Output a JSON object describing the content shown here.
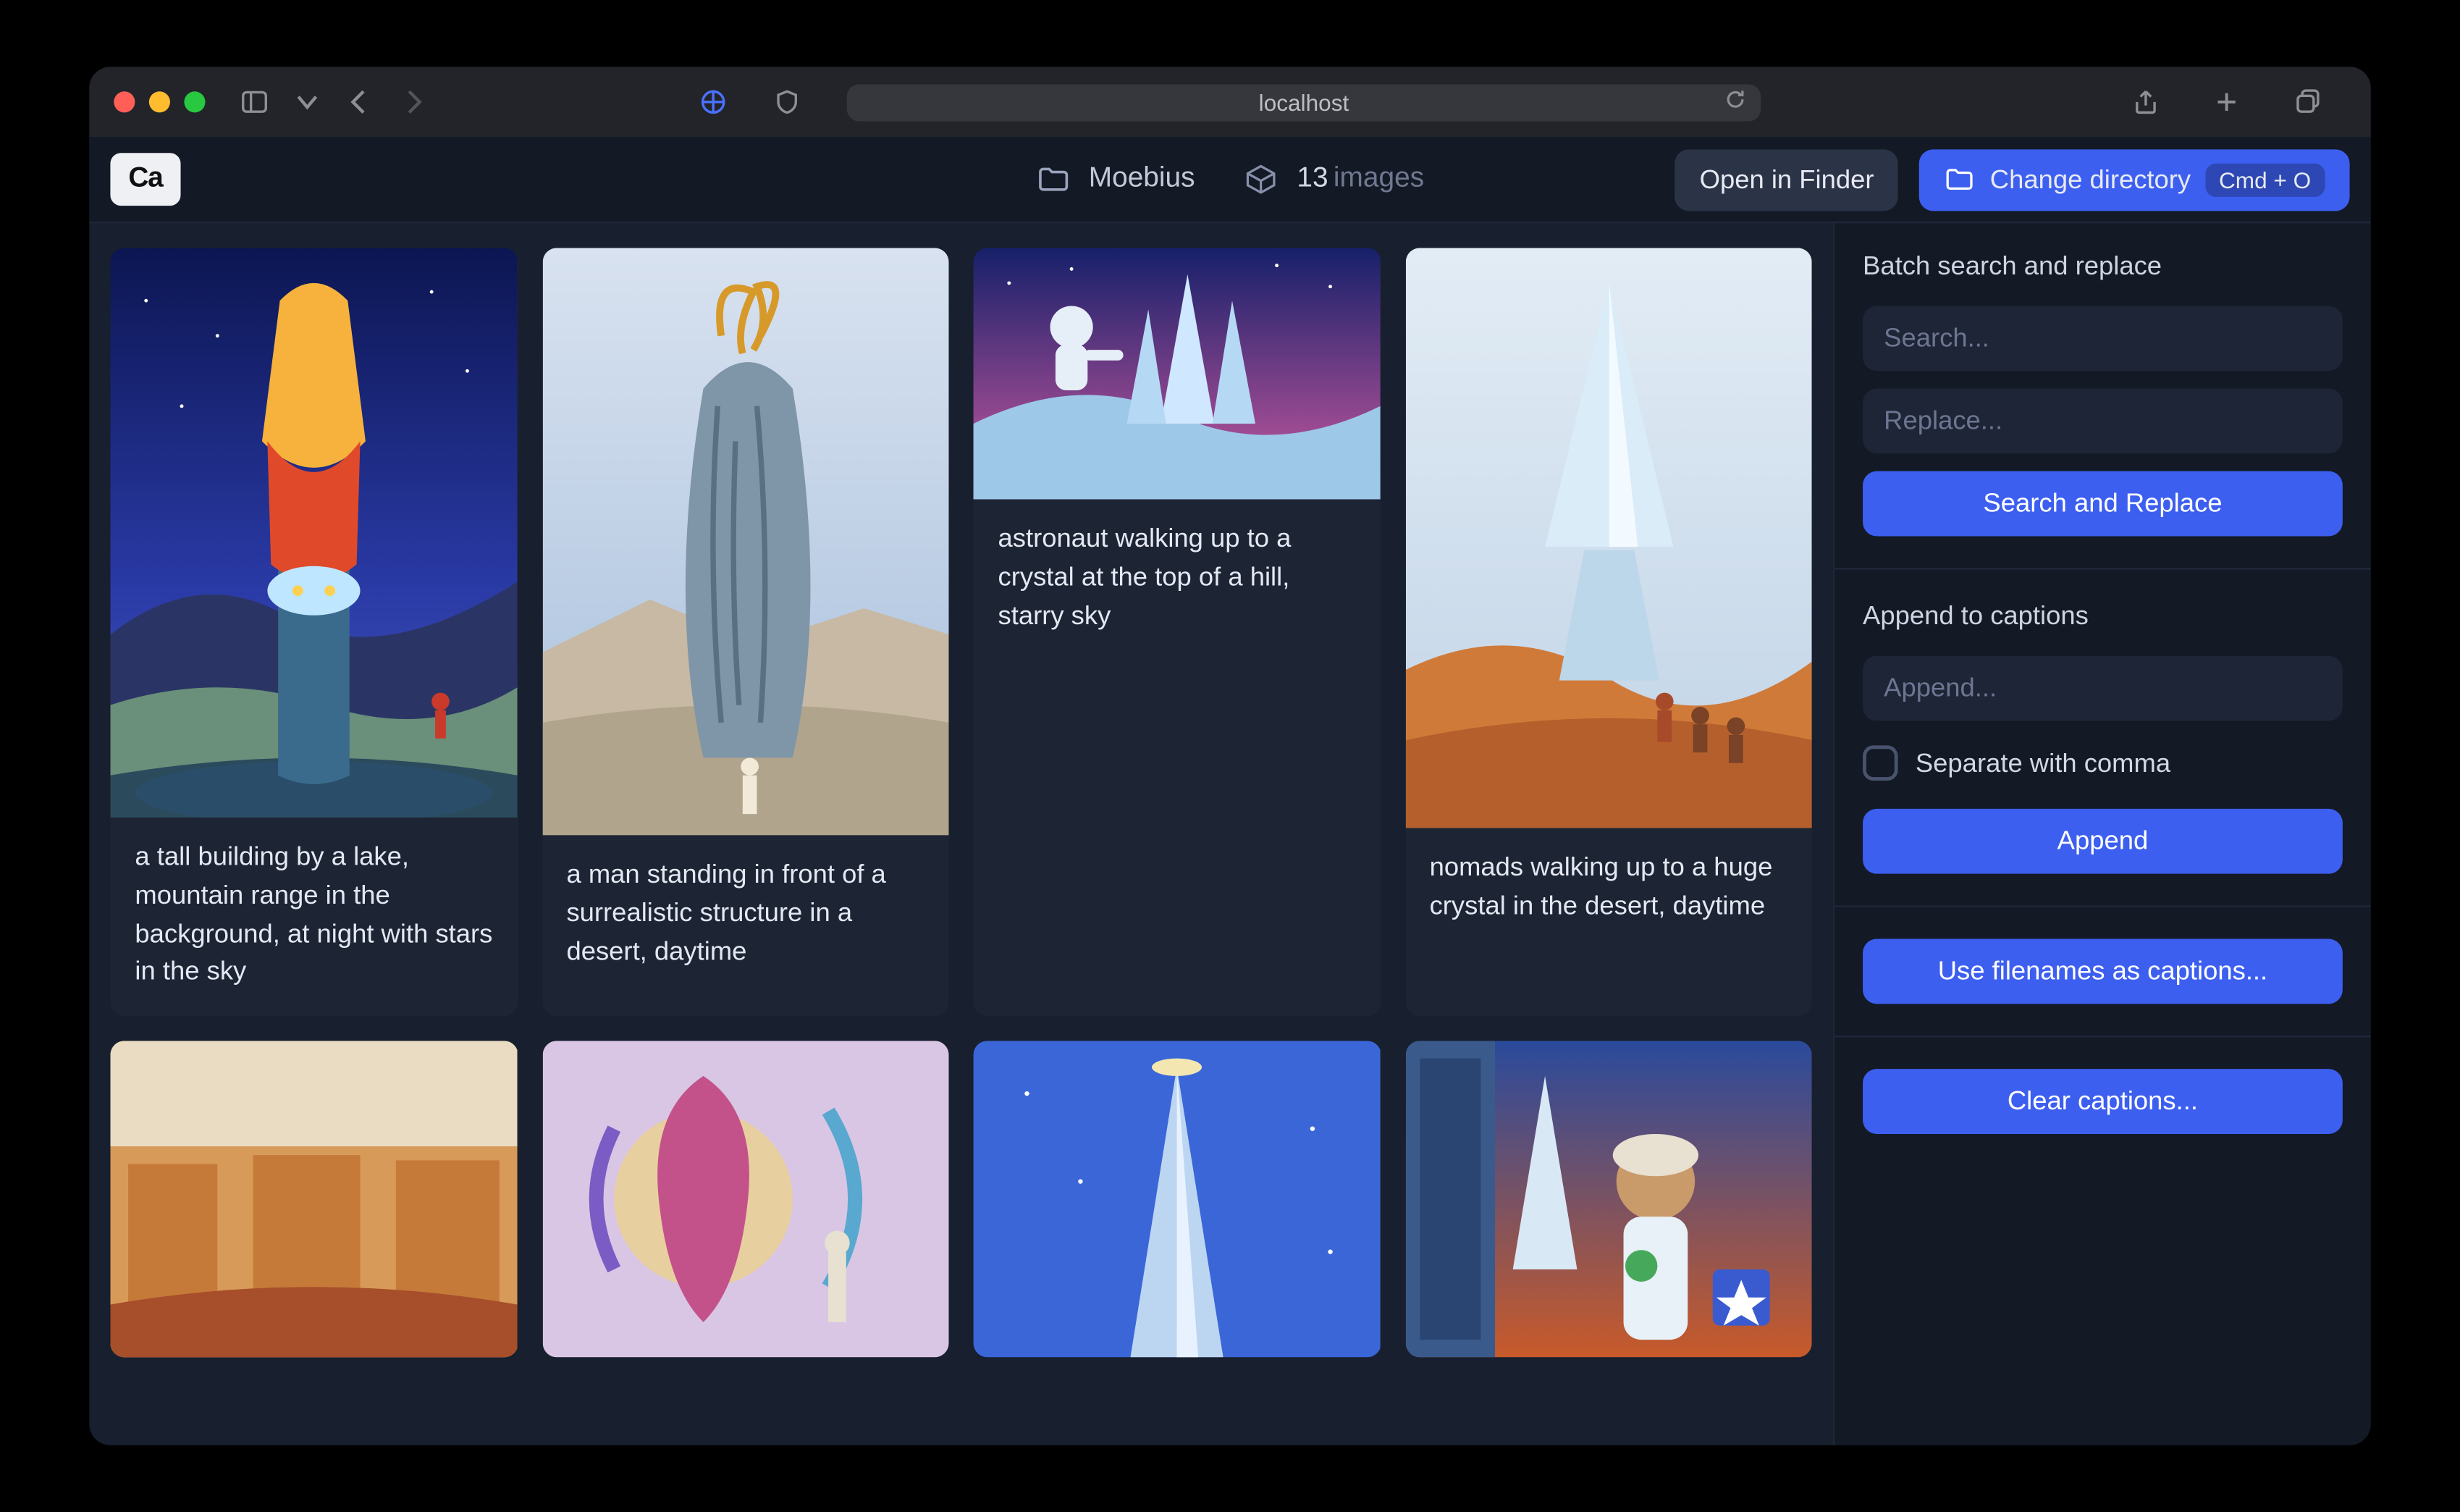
{
  "titlebar": {
    "address": "localhost"
  },
  "app": {
    "logo": "Ca",
    "folder_name": "Moebius",
    "image_count": "13",
    "image_word": "images",
    "open_finder": "Open in Finder",
    "change_dir": "Change directory",
    "change_dir_kbd": "Cmd + O"
  },
  "gallery": [
    {
      "caption": "a tall building by a lake, mountain range in the background, at night with stars in the sky"
    },
    {
      "caption": "a man standing in front of a surrealistic structure in a desert, daytime"
    },
    {
      "caption": "astronaut walking up to a crystal at the top of a hill, starry sky"
    },
    {
      "caption": "nomads walking up to a huge crystal in the desert, daytime"
    },
    {
      "caption": ""
    },
    {
      "caption": ""
    },
    {
      "caption": ""
    },
    {
      "caption": ""
    }
  ],
  "sidebar": {
    "batch_label": "Batch search and replace",
    "search_ph": "Search...",
    "replace_ph": "Replace...",
    "sr_btn": "Search and Replace",
    "append_label": "Append to captions",
    "append_ph": "Append...",
    "sep_comma": "Separate with comma",
    "append_btn": "Append",
    "use_filenames": "Use filenames as captions...",
    "clear": "Clear captions..."
  }
}
